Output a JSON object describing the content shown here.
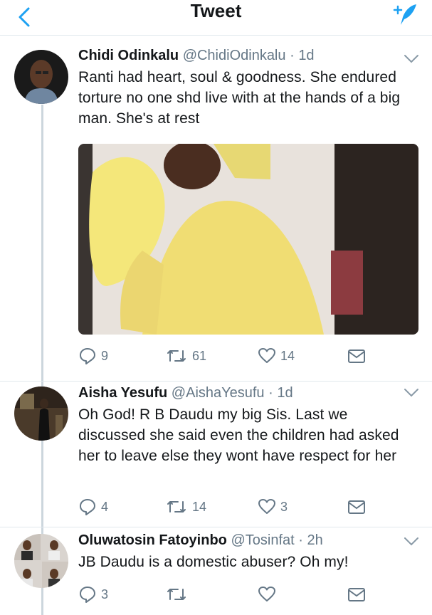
{
  "header": {
    "title": "Tweet",
    "back_icon": "chevron-left-icon",
    "compose_icon": "compose-feather-icon",
    "accent": "#1da1f2"
  },
  "tweets": [
    {
      "name": "Chidi Odinkalu",
      "handle": "@ChidiOdinkalu",
      "separator": "·",
      "time": "1d",
      "text": "Ranti had heart, soul & goodness. She endured torture no one shd live with at the hands of a big man. She's at rest",
      "replies": "9",
      "retweets": "61",
      "likes": "14"
    },
    {
      "name": "Aisha Yesufu",
      "handle": "@AishaYesufu",
      "separator": "·",
      "time": "1d",
      "text": "Oh God! R B Daudu my big Sis. Last we discussed she said even the children had asked her to leave else they wont have respect for her",
      "replies": "4",
      "retweets": "14",
      "likes": "3"
    },
    {
      "name": "Oluwatosin Fatoyinbo",
      "handle": "@Tosinfat",
      "separator": "·",
      "time": "2h",
      "text": "JB Daudu is a domestic abuser?  Oh my!",
      "replies": "3",
      "retweets": "",
      "likes": ""
    }
  ],
  "colors": {
    "text": "#14171a",
    "secondary": "#657786",
    "divider": "#e1e8ed"
  }
}
